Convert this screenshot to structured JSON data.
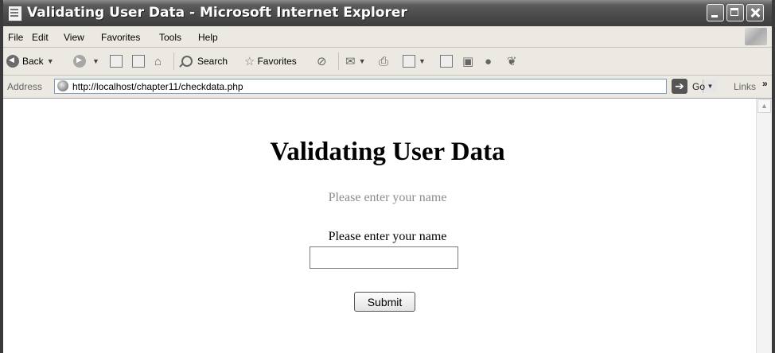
{
  "window": {
    "title": "Validating User Data - Microsoft Internet Explorer"
  },
  "menubar": {
    "items": [
      "File",
      "Edit",
      "View",
      "Favorites",
      "Tools",
      "Help"
    ]
  },
  "toolbar": {
    "back_label": "Back",
    "search_label": "Search",
    "favorites_label": "Favorites"
  },
  "addressbar": {
    "label": "Address",
    "url": "http://localhost/chapter11/checkdata.php",
    "go_label": "Go",
    "links_label": "Links",
    "links_more": "»"
  },
  "page": {
    "heading": "Validating User Data",
    "hint": "Please enter your name",
    "field_label": "Please enter your name",
    "name_value": "",
    "submit_label": "Submit"
  }
}
